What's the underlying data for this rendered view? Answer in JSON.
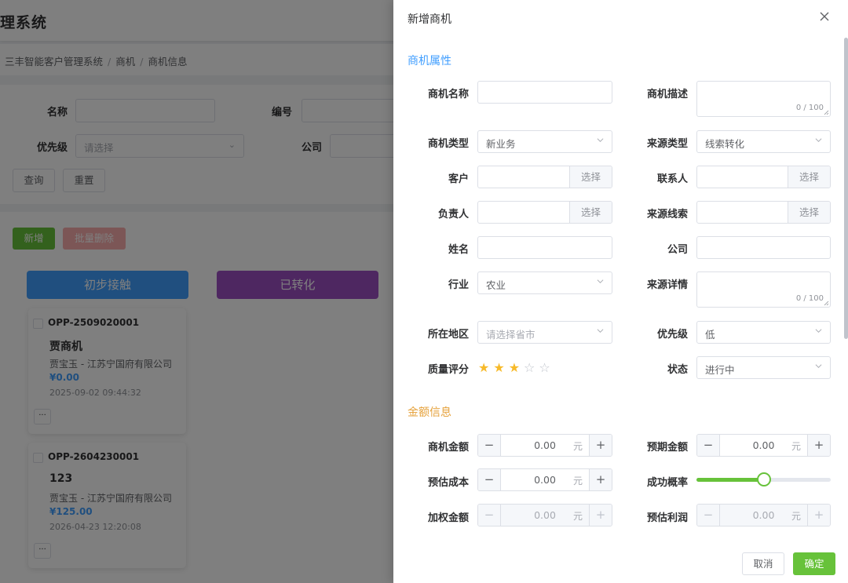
{
  "background": {
    "app_title": "理系统",
    "breadcrumb": [
      "三丰智能客户管理系统",
      "商机",
      "商机信息"
    ],
    "search": {
      "name_label": "名称",
      "code_label": "编号",
      "priority_label": "优先级",
      "priority_placeholder": "请选择",
      "company_label": "公司",
      "query_button": "查询",
      "reset_button": "重置"
    },
    "add_button": "新增",
    "batch_delete_button": "批量删除",
    "columns": [
      {
        "label": "初步接触",
        "color": "#409eff"
      },
      {
        "label": "已转化",
        "color": "#9d4fc2"
      }
    ],
    "cards": [
      {
        "code": "OPP-2509020001",
        "name": "贾商机",
        "owner": "贾宝玉 - 江苏宁国府有限公司",
        "amount": "¥0.00",
        "time": "2025-09-02 09:44:32",
        "more": "···"
      },
      {
        "code": "OPP-2604230001",
        "name": "123",
        "owner": "贾宝玉 - 江苏宁国府有限公司",
        "amount": "¥125.00",
        "time": "2026-04-23 12:20:08",
        "more": "···"
      }
    ]
  },
  "drawer": {
    "title": "新增商机",
    "section_attrs": {
      "title": "商机属性",
      "color": "#409eff"
    },
    "section_amount": {
      "title": "金额信息",
      "color": "#e6a23c"
    },
    "fields": {
      "opp_name": {
        "label": "商机名称",
        "value": ""
      },
      "opp_desc": {
        "label": "商机描述",
        "counter": "0 / 100"
      },
      "opp_type": {
        "label": "商机类型",
        "value": "新业务"
      },
      "source_type": {
        "label": "来源类型",
        "value": "线索转化"
      },
      "customer": {
        "label": "客户",
        "button": "选择"
      },
      "contact": {
        "label": "联系人",
        "button": "选择"
      },
      "owner": {
        "label": "负责人",
        "button": "选择"
      },
      "source_lead": {
        "label": "来源线索",
        "button": "选择"
      },
      "person_name": {
        "label": "姓名",
        "value": ""
      },
      "company": {
        "label": "公司",
        "value": ""
      },
      "industry": {
        "label": "行业",
        "value": "农业"
      },
      "source_detail": {
        "label": "来源详情",
        "counter": "0 / 100"
      },
      "region": {
        "label": "所在地区",
        "placeholder": "请选择省市"
      },
      "priority": {
        "label": "优先级",
        "value": "低"
      },
      "quality": {
        "label": "质量评分",
        "rating": 3,
        "max": 5
      },
      "status": {
        "label": "状态",
        "value": "进行中"
      }
    },
    "amounts": {
      "opp_amount": {
        "label": "商机金额",
        "value": "0.00",
        "unit": "元"
      },
      "expected_amount": {
        "label": "预期金额",
        "value": "0.00",
        "unit": "元"
      },
      "est_cost": {
        "label": "预估成本",
        "value": "0.00",
        "unit": "元"
      },
      "success_rate": {
        "label": "成功概率",
        "value": 50
      },
      "weighted_amount": {
        "label": "加权金额",
        "value": "0.00",
        "unit": "元"
      },
      "est_profit": {
        "label": "预估利润",
        "value": "0.00",
        "unit": "元"
      }
    },
    "cancel_button": "取消",
    "confirm_button": "确定"
  }
}
